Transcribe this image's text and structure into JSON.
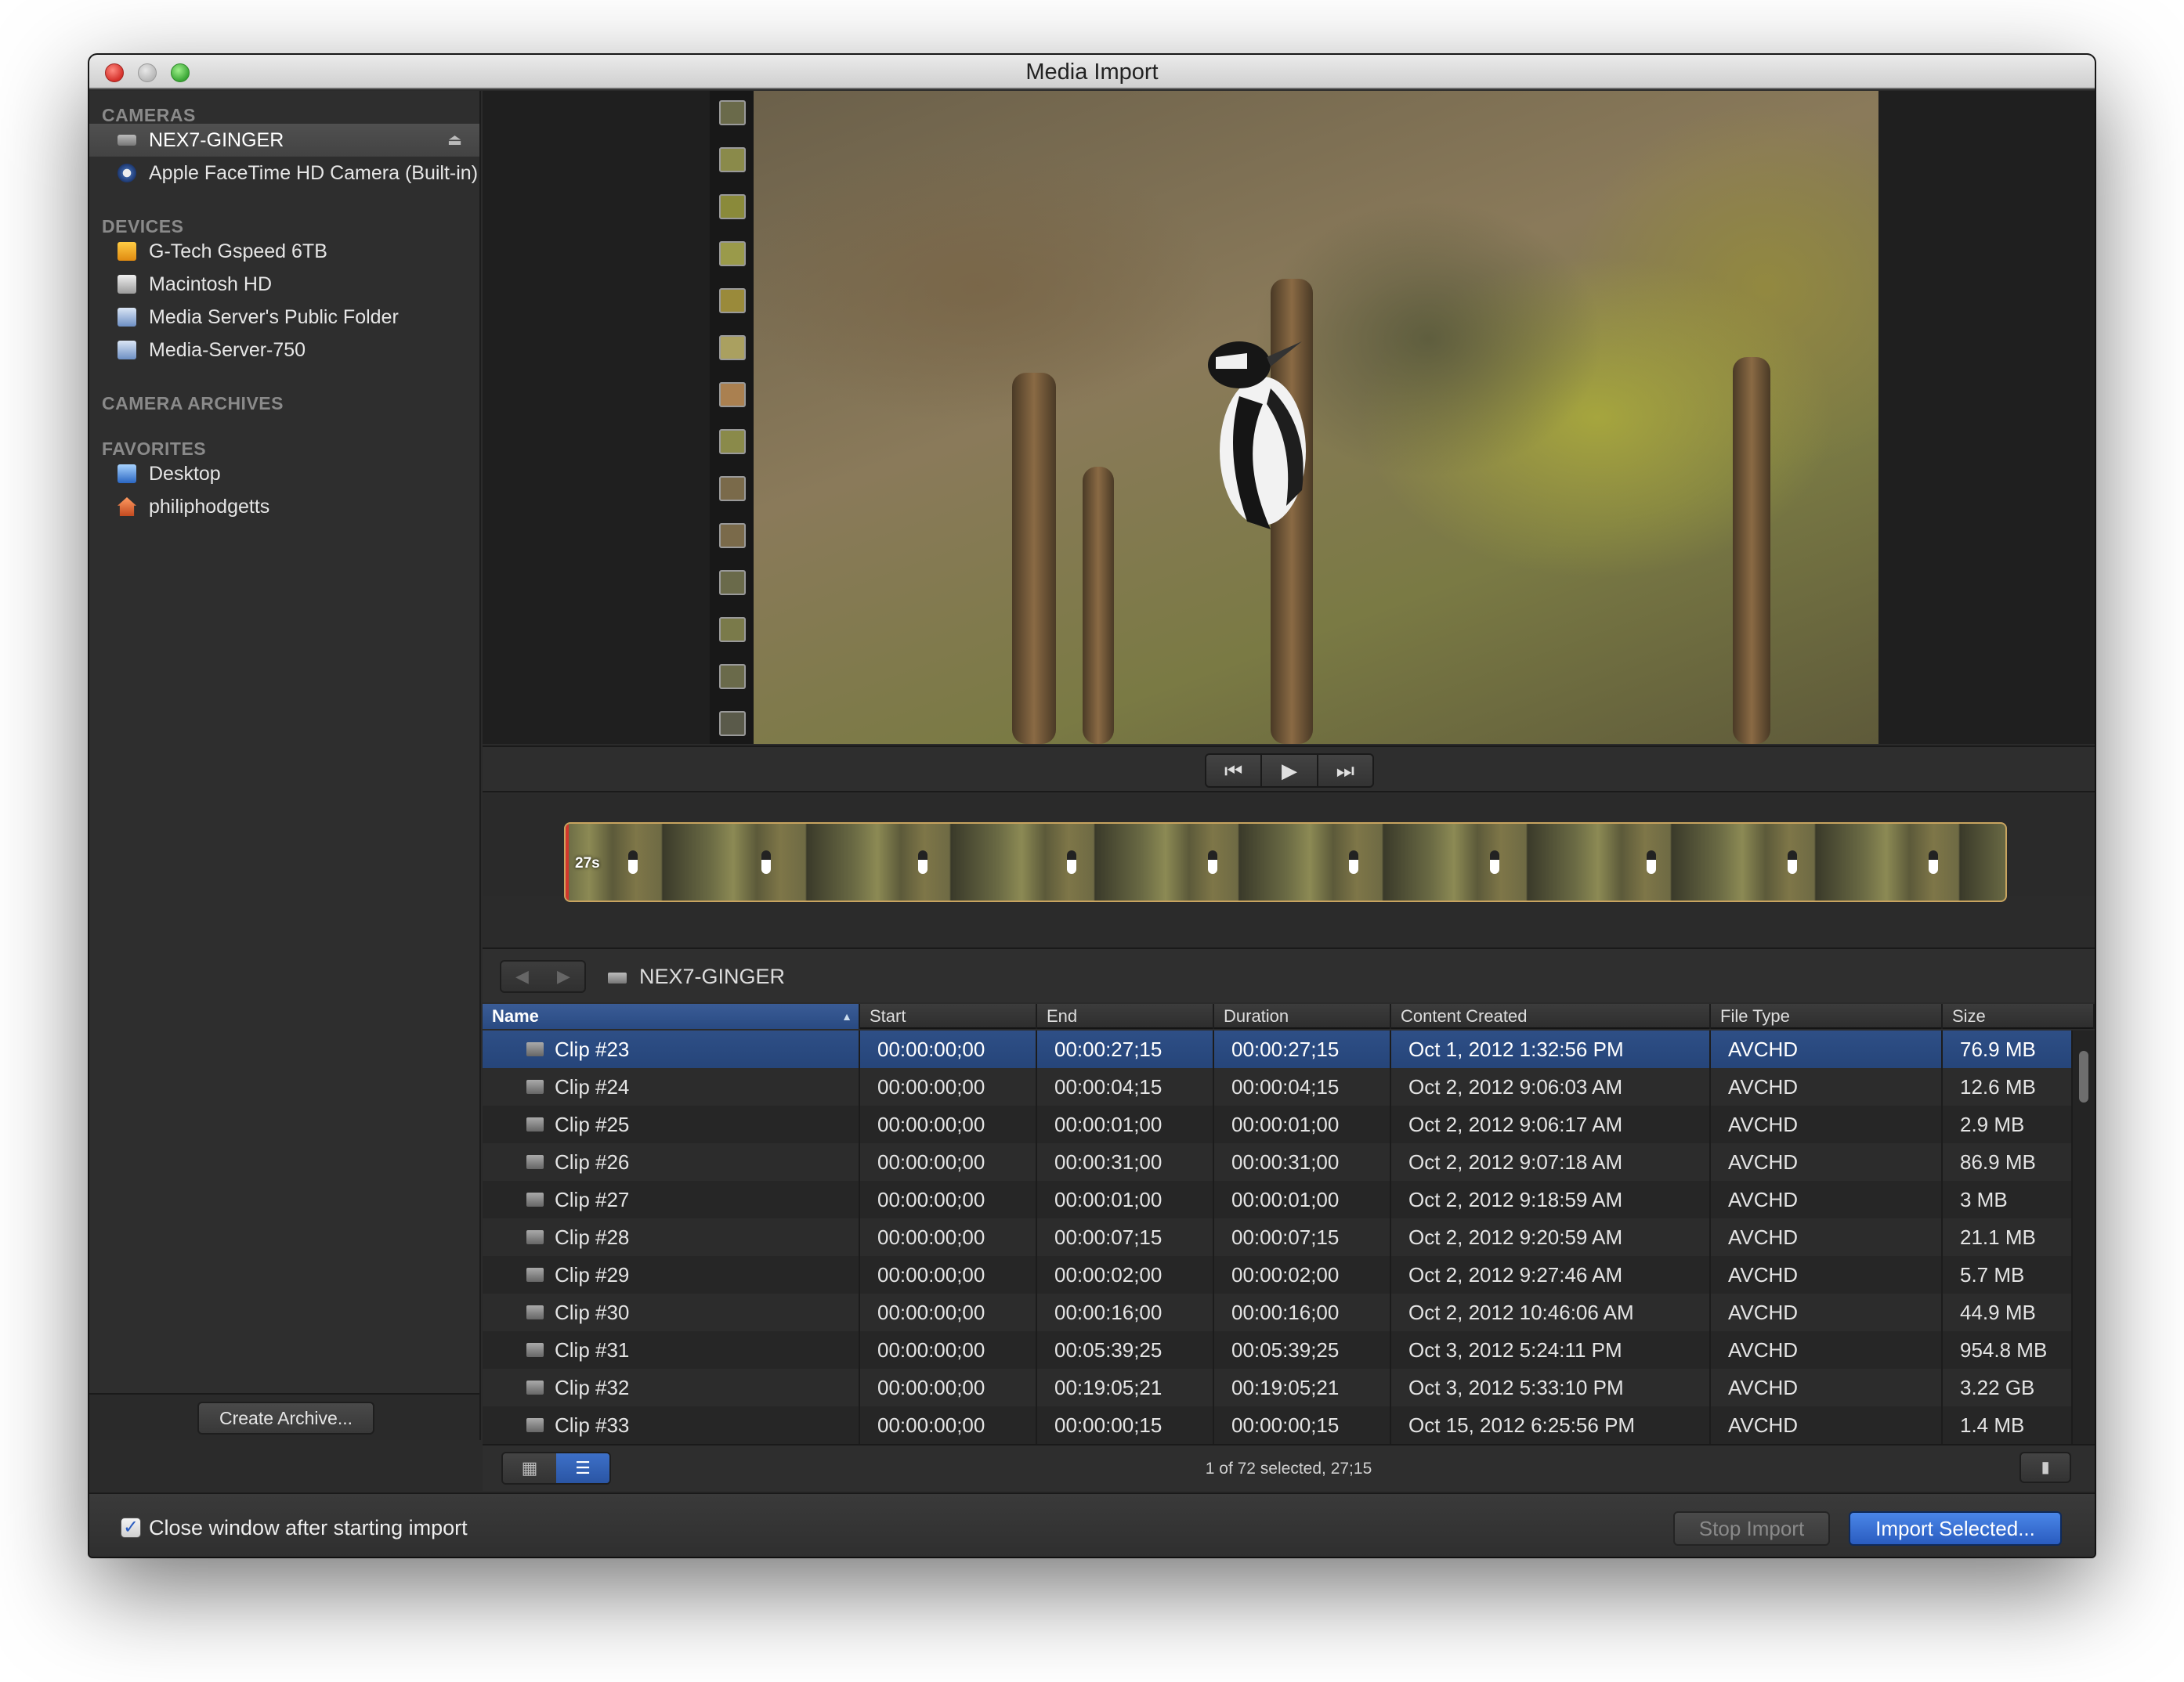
{
  "window": {
    "title": "Media Import"
  },
  "sidebar": {
    "sections": [
      {
        "header": "CAMERAS",
        "items": [
          {
            "label": "NEX7-GINGER",
            "icon": "camera-icon",
            "selected": true
          },
          {
            "label": "Apple FaceTime HD Camera (Built-in)",
            "icon": "facetime-camera-icon"
          }
        ]
      },
      {
        "header": "DEVICES",
        "items": [
          {
            "label": "G-Tech Gspeed 6TB",
            "icon": "external-drive-icon"
          },
          {
            "label": "Macintosh HD",
            "icon": "hard-drive-icon"
          },
          {
            "label": "Media Server's Public Folder",
            "icon": "server-icon"
          },
          {
            "label": "Media-Server-750",
            "icon": "server-icon"
          }
        ]
      },
      {
        "header": "CAMERA ARCHIVES",
        "items": []
      },
      {
        "header": "FAVORITES",
        "items": [
          {
            "label": "Desktop",
            "icon": "desktop-folder-icon"
          },
          {
            "label": "philiphodgetts",
            "icon": "home-folder-icon"
          }
        ]
      }
    ],
    "create_archive_label": "Create Archive..."
  },
  "timeline": {
    "duration_label": "27s"
  },
  "browser": {
    "location": "NEX7-GINGER",
    "columns": [
      "Name",
      "Start",
      "End",
      "Duration",
      "Content Created",
      "File Type",
      "Size"
    ],
    "rows": [
      {
        "name": "Clip #23",
        "start": "00:00:00;00",
        "end": "00:00:27;15",
        "duration": "00:00:27;15",
        "created": "Oct 1, 2012 1:32:56 PM",
        "type": "AVCHD",
        "size": "76.9 MB",
        "selected": true
      },
      {
        "name": "Clip #24",
        "start": "00:00:00;00",
        "end": "00:00:04;15",
        "duration": "00:00:04;15",
        "created": "Oct 2, 2012 9:06:03 AM",
        "type": "AVCHD",
        "size": "12.6 MB"
      },
      {
        "name": "Clip #25",
        "start": "00:00:00;00",
        "end": "00:00:01;00",
        "duration": "00:00:01;00",
        "created": "Oct 2, 2012 9:06:17 AM",
        "type": "AVCHD",
        "size": "2.9 MB"
      },
      {
        "name": "Clip #26",
        "start": "00:00:00;00",
        "end": "00:00:31;00",
        "duration": "00:00:31;00",
        "created": "Oct 2, 2012 9:07:18 AM",
        "type": "AVCHD",
        "size": "86.9 MB"
      },
      {
        "name": "Clip #27",
        "start": "00:00:00;00",
        "end": "00:00:01;00",
        "duration": "00:00:01;00",
        "created": "Oct 2, 2012 9:18:59 AM",
        "type": "AVCHD",
        "size": "3 MB"
      },
      {
        "name": "Clip #28",
        "start": "00:00:00;00",
        "end": "00:00:07;15",
        "duration": "00:00:07;15",
        "created": "Oct 2, 2012 9:20:59 AM",
        "type": "AVCHD",
        "size": "21.1 MB"
      },
      {
        "name": "Clip #29",
        "start": "00:00:00;00",
        "end": "00:00:02;00",
        "duration": "00:00:02;00",
        "created": "Oct 2, 2012 9:27:46 AM",
        "type": "AVCHD",
        "size": "5.7 MB"
      },
      {
        "name": "Clip #30",
        "start": "00:00:00;00",
        "end": "00:00:16;00",
        "duration": "00:00:16;00",
        "created": "Oct 2, 2012 10:46:06 AM",
        "type": "AVCHD",
        "size": "44.9 MB"
      },
      {
        "name": "Clip #31",
        "start": "00:00:00;00",
        "end": "00:05:39;25",
        "duration": "00:05:39;25",
        "created": "Oct 3, 2012 5:24:11 PM",
        "type": "AVCHD",
        "size": "954.8 MB"
      },
      {
        "name": "Clip #32",
        "start": "00:00:00;00",
        "end": "00:19:05;21",
        "duration": "00:19:05;21",
        "created": "Oct 3, 2012 5:33:10 PM",
        "type": "AVCHD",
        "size": "3.22 GB"
      },
      {
        "name": "Clip #33",
        "start": "00:00:00;00",
        "end": "00:00:00;15",
        "duration": "00:00:00;15",
        "created": "Oct 15, 2012 6:25:56 PM",
        "type": "AVCHD",
        "size": "1.4 MB"
      }
    ],
    "status": "1 of 72 selected, 27;15"
  },
  "footer": {
    "close_window_label": "Close window after starting import",
    "close_window_checked": true,
    "stop_import_label": "Stop Import",
    "import_selected_label": "Import Selected..."
  },
  "colors": {
    "selection": "#2e4f86",
    "accent": "#3d70c8",
    "close": "#d4302a",
    "minimize": "#b8b8b8",
    "zoom": "#3aa635"
  }
}
